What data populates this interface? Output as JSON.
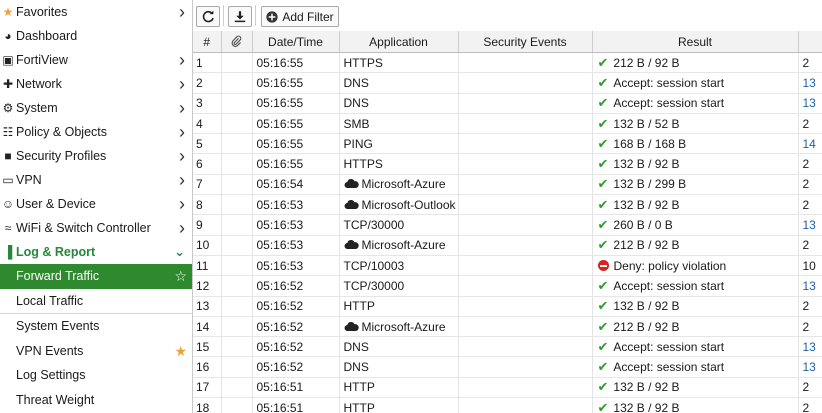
{
  "sidebar": {
    "items": [
      {
        "label": "Favorites",
        "icon": "star-icon",
        "chevron": "right"
      },
      {
        "label": "Dashboard",
        "icon": "dashboard-icon",
        "chevron": ""
      },
      {
        "label": "FortiView",
        "icon": "chart-icon",
        "chevron": "right"
      },
      {
        "label": "Network",
        "icon": "network-icon",
        "chevron": "right"
      },
      {
        "label": "System",
        "icon": "gear-icon",
        "chevron": "right"
      },
      {
        "label": "Policy & Objects",
        "icon": "document-icon",
        "chevron": "right"
      },
      {
        "label": "Security Profiles",
        "icon": "lock-icon",
        "chevron": "right"
      },
      {
        "label": "VPN",
        "icon": "monitor-icon",
        "chevron": "right"
      },
      {
        "label": "User & Device",
        "icon": "user-icon",
        "chevron": "right"
      },
      {
        "label": "WiFi & Switch Controller",
        "icon": "wifi-icon",
        "chevron": "right"
      },
      {
        "label": "Log & Report",
        "icon": "bar-chart-icon",
        "chevron": "down"
      }
    ],
    "sub_items": [
      {
        "label": "Forward Traffic",
        "star": "outline"
      },
      {
        "label": "Local Traffic",
        "star": ""
      },
      {
        "label": "System Events",
        "star": ""
      },
      {
        "label": "VPN Events",
        "star": "filled"
      },
      {
        "label": "Log Settings",
        "star": ""
      },
      {
        "label": "Threat Weight",
        "star": ""
      }
    ]
  },
  "toolbar": {
    "add_filter_label": "Add Filter"
  },
  "table": {
    "columns": [
      "#",
      "Date/Time",
      "Application",
      "Security Events",
      "Result"
    ],
    "rows": [
      {
        "n": "1",
        "time": "05:16:55",
        "app": "HTTPS",
        "cloud": false,
        "result": "212 B / 92 B",
        "status": "ok",
        "extra": "2",
        "extra_link": false
      },
      {
        "n": "2",
        "time": "05:16:55",
        "app": "DNS",
        "cloud": false,
        "result": "Accept: session start",
        "status": "ok",
        "extra": "13",
        "extra_link": true
      },
      {
        "n": "3",
        "time": "05:16:55",
        "app": "DNS",
        "cloud": false,
        "result": "Accept: session start",
        "status": "ok",
        "extra": "13",
        "extra_link": true
      },
      {
        "n": "4",
        "time": "05:16:55",
        "app": "SMB",
        "cloud": false,
        "result": "132 B / 52 B",
        "status": "ok",
        "extra": "2",
        "extra_link": false
      },
      {
        "n": "5",
        "time": "05:16:55",
        "app": "PING",
        "cloud": false,
        "result": "168 B / 168 B",
        "status": "ok",
        "extra": "14",
        "extra_link": true
      },
      {
        "n": "6",
        "time": "05:16:55",
        "app": "HTTPS",
        "cloud": false,
        "result": "132 B / 92 B",
        "status": "ok",
        "extra": "2",
        "extra_link": false
      },
      {
        "n": "7",
        "time": "05:16:54",
        "app": "Microsoft-Azure",
        "cloud": true,
        "result": "132 B / 299 B",
        "status": "ok",
        "extra": "2",
        "extra_link": false
      },
      {
        "n": "8",
        "time": "05:16:53",
        "app": "Microsoft-Outlook",
        "cloud": true,
        "result": "132 B / 92 B",
        "status": "ok",
        "extra": "2",
        "extra_link": false
      },
      {
        "n": "9",
        "time": "05:16:53",
        "app": "TCP/30000",
        "cloud": false,
        "result": "260 B / 0 B",
        "status": "ok",
        "extra": "13",
        "extra_link": true
      },
      {
        "n": "10",
        "time": "05:16:53",
        "app": "Microsoft-Azure",
        "cloud": true,
        "result": "212 B / 92 B",
        "status": "ok",
        "extra": "2",
        "extra_link": false
      },
      {
        "n": "11",
        "time": "05:16:53",
        "app": "TCP/10003",
        "cloud": false,
        "result": "Deny: policy violation",
        "status": "deny",
        "extra": "10",
        "extra_link": false
      },
      {
        "n": "12",
        "time": "05:16:52",
        "app": "TCP/30000",
        "cloud": false,
        "result": "Accept: session start",
        "status": "ok",
        "extra": "13",
        "extra_link": true
      },
      {
        "n": "13",
        "time": "05:16:52",
        "app": "HTTP",
        "cloud": false,
        "result": "132 B / 92 B",
        "status": "ok",
        "extra": "2",
        "extra_link": false
      },
      {
        "n": "14",
        "time": "05:16:52",
        "app": "Microsoft-Azure",
        "cloud": true,
        "result": "212 B / 92 B",
        "status": "ok",
        "extra": "2",
        "extra_link": false
      },
      {
        "n": "15",
        "time": "05:16:52",
        "app": "DNS",
        "cloud": false,
        "result": "Accept: session start",
        "status": "ok",
        "extra": "13",
        "extra_link": true
      },
      {
        "n": "16",
        "time": "05:16:52",
        "app": "DNS",
        "cloud": false,
        "result": "Accept: session start",
        "status": "ok",
        "extra": "13",
        "extra_link": true
      },
      {
        "n": "17",
        "time": "05:16:51",
        "app": "HTTP",
        "cloud": false,
        "result": "132 B / 92 B",
        "status": "ok",
        "extra": "2",
        "extra_link": false
      },
      {
        "n": "18",
        "time": "05:16:51",
        "app": "HTTP",
        "cloud": false,
        "result": "132 B / 92 B",
        "status": "ok",
        "extra": "2",
        "extra_link": false
      }
    ]
  },
  "colors": {
    "accent_green": "#2f8a2f",
    "check_green": "#2e9a2e",
    "deny_red": "#d9231f",
    "link_blue": "#1d62a8",
    "star_orange": "#f0a03a"
  }
}
